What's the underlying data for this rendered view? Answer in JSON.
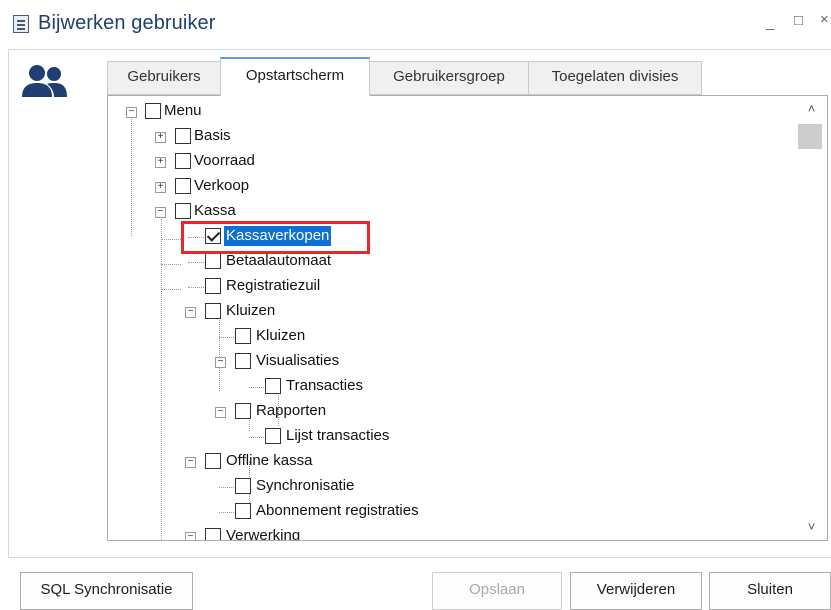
{
  "window": {
    "title": "Bijwerken gebruiker",
    "controls": {
      "minimize": "_",
      "maximize": "□",
      "close": "×"
    }
  },
  "tabs": [
    "Gebruikers",
    "Opstartscherm",
    "Gebruikersgroep",
    "Toegelaten divisies"
  ],
  "active_tab": "Opstartscherm",
  "tree": {
    "items": [
      {
        "label": "Menu",
        "level": 0,
        "expander": "minus",
        "checked": false
      },
      {
        "label": "Basis",
        "level": 1,
        "expander": "plus",
        "checked": false
      },
      {
        "label": "Voorraad",
        "level": 1,
        "expander": "plus",
        "checked": false
      },
      {
        "label": "Verkoop",
        "level": 1,
        "expander": "plus",
        "checked": false
      },
      {
        "label": "Kassa",
        "level": 1,
        "expander": "minus",
        "checked": false
      },
      {
        "label": "Kassaverkopen",
        "level": 2,
        "expander": "none",
        "checked": true,
        "selected": true
      },
      {
        "label": "Betaalautomaat",
        "level": 2,
        "expander": "none",
        "checked": false
      },
      {
        "label": "Registratiezuil",
        "level": 2,
        "expander": "none",
        "checked": false
      },
      {
        "label": "Kluizen",
        "level": 2,
        "expander": "minus",
        "checked": false
      },
      {
        "label": "Kluizen",
        "level": 3,
        "expander": "none",
        "checked": false
      },
      {
        "label": "Visualisaties",
        "level": 3,
        "expander": "minus",
        "checked": false
      },
      {
        "label": "Transacties",
        "level": 4,
        "expander": "none",
        "checked": false
      },
      {
        "label": "Rapporten",
        "level": 3,
        "expander": "minus",
        "checked": false
      },
      {
        "label": "Lijst transacties",
        "level": 4,
        "expander": "none",
        "checked": false
      },
      {
        "label": "Offline kassa",
        "level": 2,
        "expander": "minus",
        "checked": false
      },
      {
        "label": "Synchronisatie",
        "level": 3,
        "expander": "none",
        "checked": false
      },
      {
        "label": "Abonnement registraties",
        "level": 3,
        "expander": "none",
        "checked": false
      },
      {
        "label": "Verwerking",
        "level": 2,
        "expander": "minus",
        "checked": false
      }
    ]
  },
  "scrollbar": {
    "up": "˄",
    "down": "˅"
  },
  "buttons": {
    "sql_sync": "SQL Synchronisatie",
    "save": "Opslaan",
    "delete": "Verwijderen",
    "close": "Sluiten"
  },
  "colors": {
    "title": "#1f3f73",
    "accent_tab": "#5b9bd5",
    "selection": "#0f6fd4",
    "highlight_box": "#e8262e",
    "users_icon": "#1f3f73"
  }
}
